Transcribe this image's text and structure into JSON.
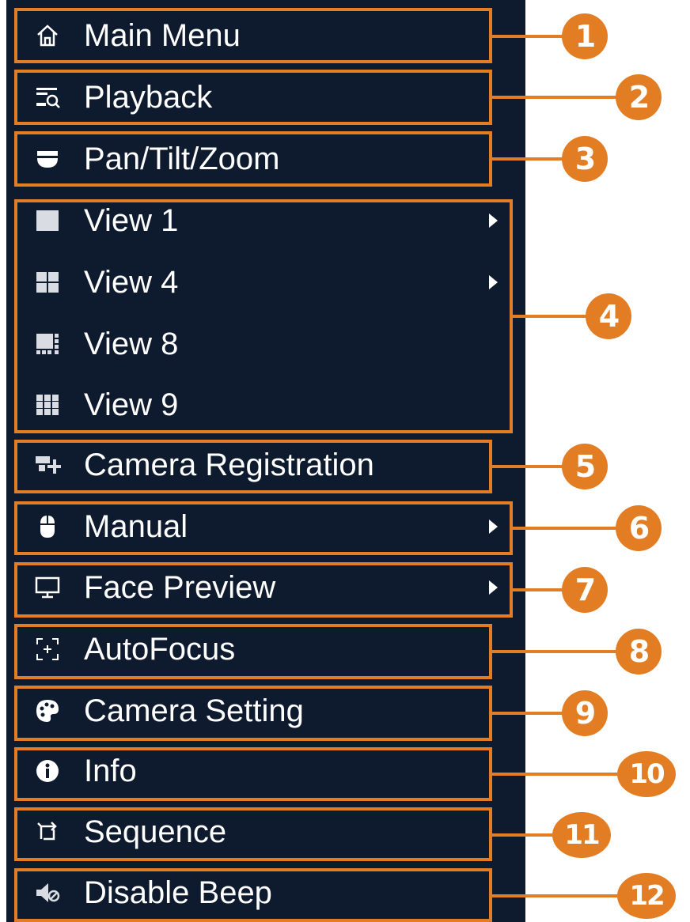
{
  "menu": {
    "items": [
      {
        "label": "Main Menu",
        "icon": "home-icon",
        "has_submenu": false
      },
      {
        "label": "Playback",
        "icon": "playback-icon",
        "has_submenu": false
      },
      {
        "label": "Pan/Tilt/Zoom",
        "icon": "ptz-icon",
        "has_submenu": false
      },
      {
        "label": "View 1",
        "icon": "view-1-icon",
        "has_submenu": true
      },
      {
        "label": "View 4",
        "icon": "view-4-icon",
        "has_submenu": true
      },
      {
        "label": "View 8",
        "icon": "view-8-icon",
        "has_submenu": false
      },
      {
        "label": "View 9",
        "icon": "view-9-icon",
        "has_submenu": false
      },
      {
        "label": "Camera Registration",
        "icon": "camera-registration-icon",
        "has_submenu": false
      },
      {
        "label": "Manual",
        "icon": "mouse-icon",
        "has_submenu": true
      },
      {
        "label": "Face Preview",
        "icon": "monitor-icon",
        "has_submenu": true
      },
      {
        "label": "AutoFocus",
        "icon": "autofocus-icon",
        "has_submenu": false
      },
      {
        "label": "Camera Setting",
        "icon": "palette-icon",
        "has_submenu": false
      },
      {
        "label": "Info",
        "icon": "info-icon",
        "has_submenu": false
      },
      {
        "label": "Sequence",
        "icon": "sequence-icon",
        "has_submenu": false
      },
      {
        "label": "Disable Beep",
        "icon": "mute-icon",
        "has_submenu": false
      }
    ]
  },
  "callouts": [
    "1",
    "2",
    "3",
    "4",
    "5",
    "6",
    "7",
    "8",
    "9",
    "10",
    "11",
    "12"
  ],
  "colors": {
    "menu_background": "#0e1a2d",
    "highlight": "#e37d23",
    "text": "#ffffff"
  }
}
